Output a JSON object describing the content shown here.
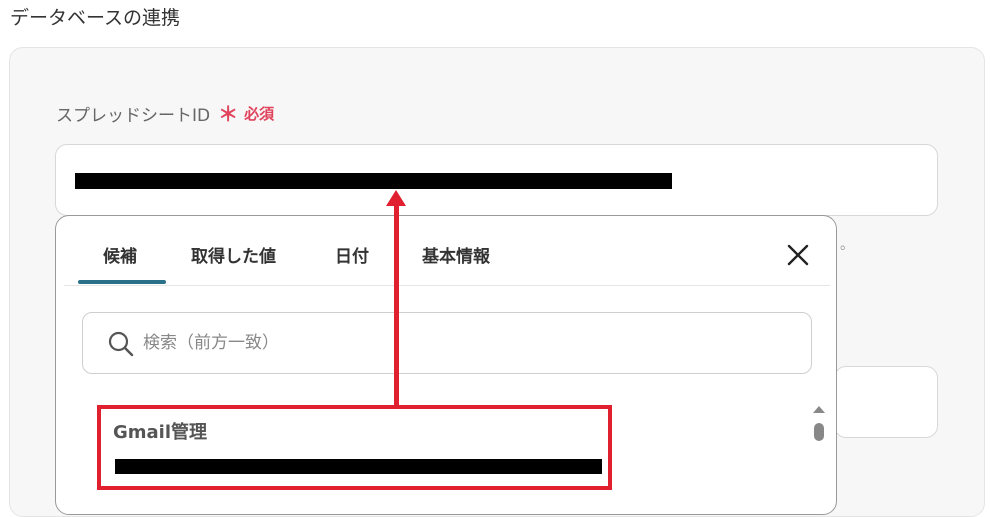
{
  "section": {
    "title": "データベースの連携"
  },
  "field": {
    "label": "スプレッドシートID",
    "required_mark": "＊",
    "required_text": "必須"
  },
  "popover": {
    "tabs": [
      {
        "label": "候補",
        "active": true
      },
      {
        "label": "取得した値",
        "active": false
      },
      {
        "label": "日付",
        "active": false
      },
      {
        "label": "基本情報",
        "active": false
      }
    ],
    "close_icon": "close-icon",
    "search": {
      "placeholder": "検索（前方一致）",
      "value": "",
      "icon": "search-icon"
    },
    "results": [
      {
        "title": "Gmail管理"
      }
    ]
  },
  "annotation": {
    "color": "#e0202e"
  },
  "colors": {
    "accent": "#2b7089",
    "required": "#e0435b",
    "annotation": "#e0202e"
  }
}
